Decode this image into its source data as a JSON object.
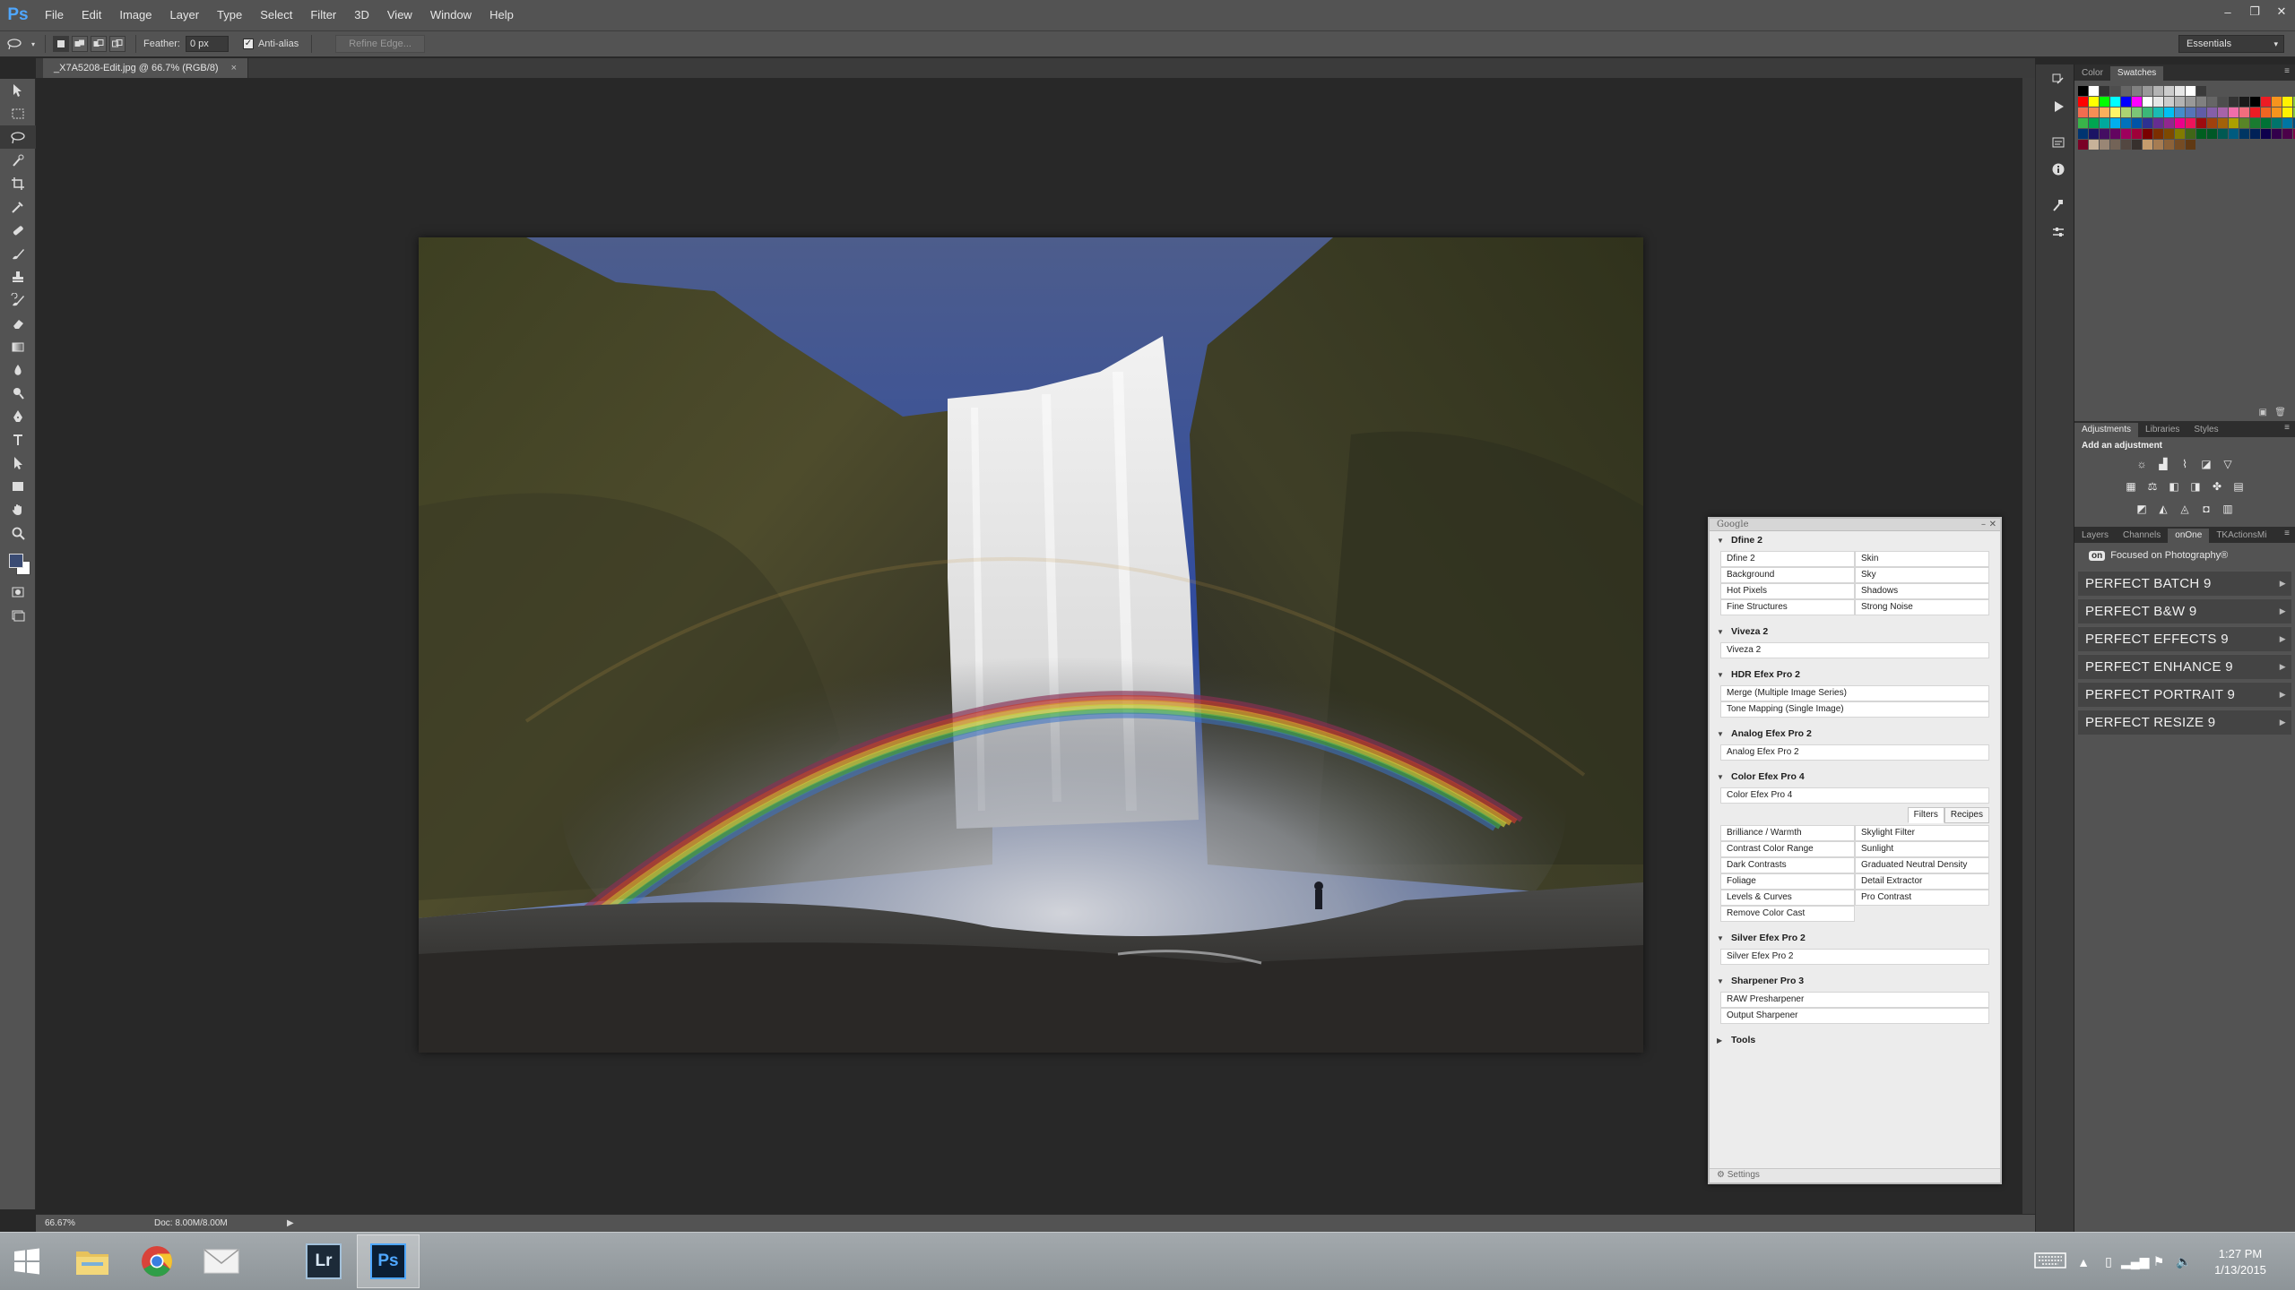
{
  "app": {
    "logo": "Ps"
  },
  "menu": [
    "File",
    "Edit",
    "Image",
    "Layer",
    "Type",
    "Select",
    "Filter",
    "3D",
    "View",
    "Window",
    "Help"
  ],
  "window_controls": {
    "minimize": "–",
    "restore": "❐",
    "close": "✕"
  },
  "options": {
    "feather_label": "Feather:",
    "feather_value": "0 px",
    "antialias_label": "Anti-alias",
    "antialias_checked": true,
    "refine_edge_label": "Refine Edge...",
    "workspace": "Essentials"
  },
  "document": {
    "tab_title": "_X7A5208-Edit.jpg @ 66.7% (RGB/8)",
    "close_glyph": "×"
  },
  "status": {
    "zoom": "66.67%",
    "doc_info": "Doc: 8.00M/8.00M",
    "arrow": "▶"
  },
  "nik": {
    "title": "Google",
    "sections": [
      {
        "name": "Dfine 2",
        "expanded": true,
        "type": "grid",
        "items": [
          "Dfine 2",
          "Skin",
          "Background",
          "Sky",
          "Hot Pixels",
          "Shadows",
          "Fine Structures",
          "Strong Noise"
        ]
      },
      {
        "name": "Viveza 2",
        "expanded": true,
        "type": "full",
        "items": [
          "Viveza 2"
        ]
      },
      {
        "name": "HDR Efex Pro 2",
        "expanded": true,
        "type": "full",
        "items": [
          "Merge (Multiple Image Series)",
          "Tone Mapping (Single Image)"
        ]
      },
      {
        "name": "Analog Efex Pro 2",
        "expanded": true,
        "type": "full",
        "items": [
          "Analog Efex Pro 2"
        ]
      },
      {
        "name": "Color Efex Pro 4",
        "expanded": true,
        "type": "full",
        "items": [
          "Color Efex Pro 4"
        ]
      },
      {
        "name": "",
        "expanded": true,
        "type": "cef-grid",
        "items": [
          "Brilliance / Warmth",
          "Skylight Filter",
          "Contrast Color Range",
          "Sunlight",
          "Dark Contrasts",
          "Graduated Neutral Density",
          "Foliage",
          "Detail Extractor",
          "Levels & Curves",
          "Pro Contrast",
          "Remove Color Cast",
          ""
        ]
      },
      {
        "name": "Silver Efex Pro 2",
        "expanded": true,
        "type": "full",
        "items": [
          "Silver Efex Pro 2"
        ]
      },
      {
        "name": "Sharpener Pro 3",
        "expanded": true,
        "type": "full",
        "items": [
          "RAW Presharpener",
          "Output Sharpener"
        ]
      },
      {
        "name": "Tools",
        "expanded": false,
        "type": "full",
        "items": []
      }
    ],
    "cef_tabs": [
      "Filters",
      "Recipes"
    ],
    "footer": "Settings"
  },
  "right_panels": {
    "color_tabs": [
      "Color",
      "Swatches"
    ],
    "adjust_tabs": [
      "Adjustments",
      "Libraries",
      "Styles"
    ],
    "adjust_heading": "Add an adjustment",
    "layers_tabs": [
      "Layers",
      "Channels",
      "onOne",
      "TKActionsMi"
    ],
    "onone_logo": "on",
    "onone_tagline": "Focused on Photography®",
    "onone_items": [
      "PERFECT BATCH 9",
      "PERFECT B&W 9",
      "PERFECT EFFECTS 9",
      "PERFECT ENHANCE 9",
      "PERFECT PORTRAIT 9",
      "PERFECT RESIZE 9"
    ],
    "refresh": "refresh"
  },
  "taskbar": {
    "apps": [
      {
        "name": "file-explorer",
        "label": ""
      },
      {
        "name": "chrome",
        "label": ""
      },
      {
        "name": "mail",
        "label": ""
      },
      {
        "name": "lightroom",
        "label": "Lr"
      },
      {
        "name": "photoshop",
        "label": "Ps"
      }
    ],
    "time": "1:27 PM",
    "date": "1/13/2015"
  },
  "colors": {
    "accent_ps": "#4fa7ff",
    "panel_bg": "#535353",
    "canvas_bg": "#282828"
  }
}
